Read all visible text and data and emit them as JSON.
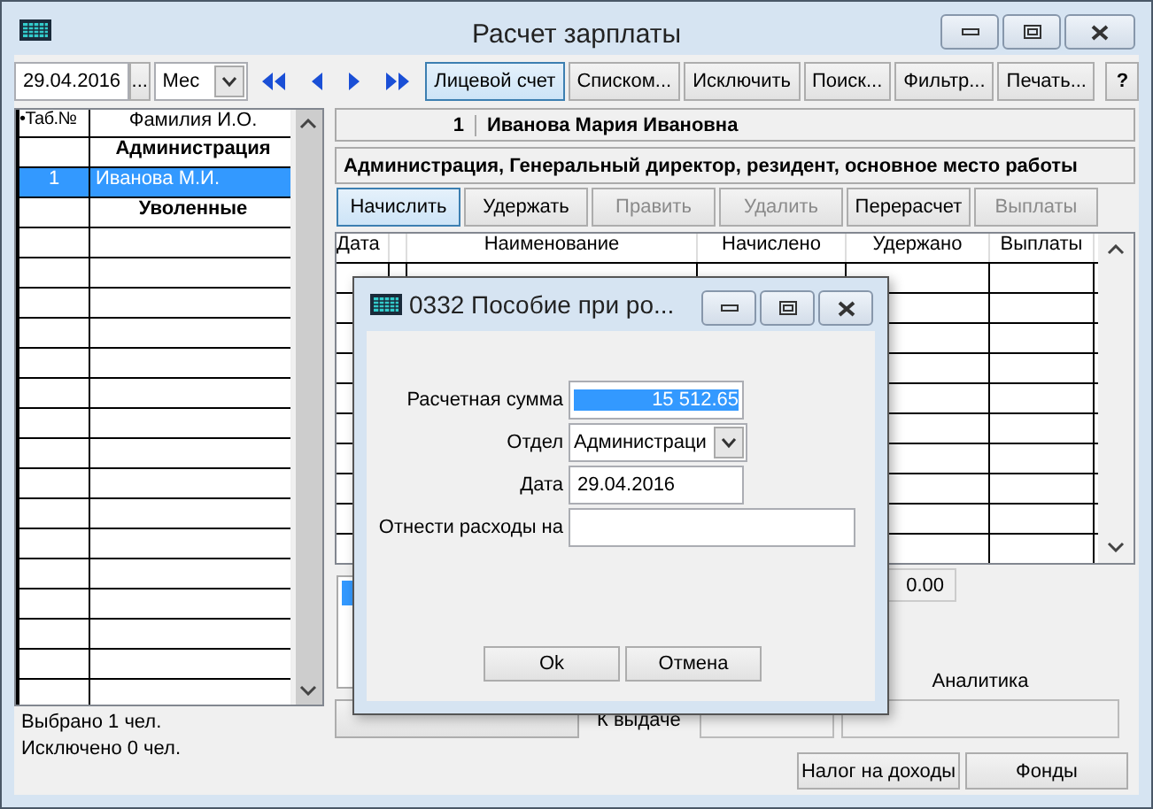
{
  "window": {
    "title": "Расчет зарплаты"
  },
  "toolbar": {
    "date": "29.04.2016",
    "date_button": "...",
    "period": "Мес",
    "help": "?",
    "buttons": [
      {
        "label": "Лицевой счет",
        "selected": true
      },
      {
        "label": "Списком...",
        "selected": false
      },
      {
        "label": "Исключить",
        "selected": false
      },
      {
        "label": "Поиск...",
        "selected": false
      },
      {
        "label": "Фильтр...",
        "selected": false
      },
      {
        "label": "Печать...",
        "selected": false
      }
    ]
  },
  "employee_list": {
    "columns": [
      "•Таб.№",
      "Фамилия И.О."
    ],
    "rows": [
      {
        "kind": "group",
        "name": "Администрация",
        "selected": false
      },
      {
        "kind": "employee",
        "number": "1",
        "name": "Иванова М.И.",
        "selected": true
      },
      {
        "kind": "group",
        "name": "Уволенные",
        "selected": false
      }
    ],
    "summary": [
      "Выбрано 1 чел.",
      "Исключено 0 чел."
    ]
  },
  "employee": {
    "number": "1",
    "name": "Иванова Мария Ивановна",
    "details": "Администрация, Генеральный директор, резидент, основное место работы"
  },
  "actions": [
    {
      "label": "Начислить",
      "selected": true,
      "disabled": false
    },
    {
      "label": "Удержать",
      "selected": false,
      "disabled": false
    },
    {
      "label": "Править",
      "selected": false,
      "disabled": true
    },
    {
      "label": "Удалить",
      "selected": false,
      "disabled": true
    },
    {
      "label": "Перерасчет",
      "selected": false,
      "disabled": false
    },
    {
      "label": "Выплаты",
      "selected": false,
      "disabled": true
    }
  ],
  "ledger": {
    "columns": [
      "Дата",
      "Наименование",
      "Начислено",
      "Удержано",
      "Выплаты"
    ],
    "total": "0.00"
  },
  "footer": {
    "payout_label": "К выдаче",
    "analytics_label": "Аналитика"
  },
  "bottom_buttons": [
    "Налог на доходы",
    "Фонды"
  ],
  "dialog": {
    "title": "0332 Пособие при ро...",
    "fields": [
      {
        "kind": "amount",
        "label": "Расчетная сумма",
        "value": "15 512.65"
      },
      {
        "kind": "select",
        "label": "Отдел",
        "value": "Администраци"
      },
      {
        "kind": "text",
        "label": "Дата",
        "value": "29.04.2016"
      },
      {
        "kind": "text",
        "label": "Отнести расходы на"
      }
    ],
    "buttons": [
      "Ok",
      "Отмена"
    ]
  }
}
